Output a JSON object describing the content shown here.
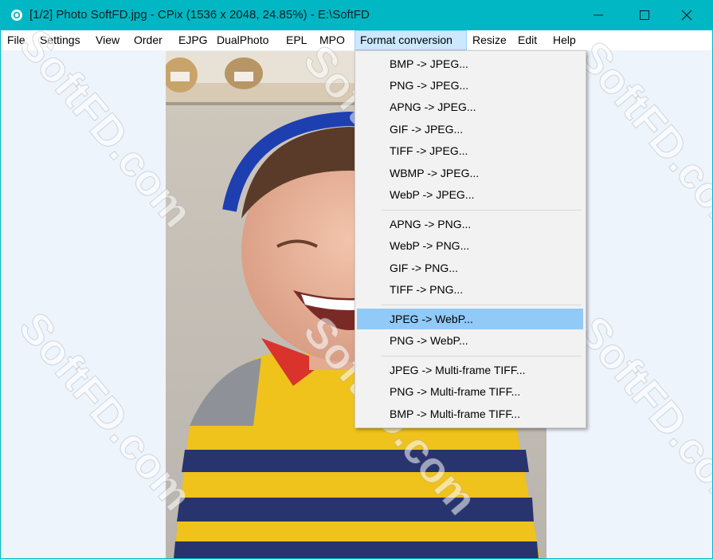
{
  "window": {
    "title": "[1/2] Photo SoftFD.jpg - CPix (1536 x 2048, 24.85%) - E:\\SoftFD",
    "accent_color": "#00b7c3",
    "controls": [
      "minimize-icon",
      "maximize-icon",
      "close-icon"
    ]
  },
  "menubar": {
    "items": [
      {
        "label": "File"
      },
      {
        "label": "Settings"
      },
      {
        "label": "View"
      },
      {
        "label": "Order"
      },
      {
        "label": "EJPG"
      },
      {
        "label": "DualPhoto"
      },
      {
        "label": "EPL"
      },
      {
        "label": "MPO"
      },
      {
        "label": "Format conversion",
        "active": true
      },
      {
        "label": "Resize"
      },
      {
        "label": "Edit"
      },
      {
        "label": "Help"
      }
    ]
  },
  "dropdown": {
    "groups": [
      [
        "BMP -> JPEG...",
        "PNG -> JPEG...",
        "APNG -> JPEG...",
        "GIF -> JPEG...",
        "TIFF -> JPEG...",
        "WBMP -> JPEG...",
        "WebP -> JPEG..."
      ],
      [
        "APNG -> PNG...",
        "WebP -> PNG...",
        "GIF -> PNG...",
        "TIFF -> PNG..."
      ],
      [
        "JPEG -> WebP...",
        "PNG -> WebP..."
      ],
      [
        "JPEG -> Multi-frame TIFF...",
        "PNG -> Multi-frame TIFF...",
        "BMP -> Multi-frame TIFF..."
      ]
    ],
    "highlighted": "JPEG -> WebP...",
    "highlight_color": "#91c9f7"
  },
  "watermark": {
    "text": "SoftFD.com"
  }
}
